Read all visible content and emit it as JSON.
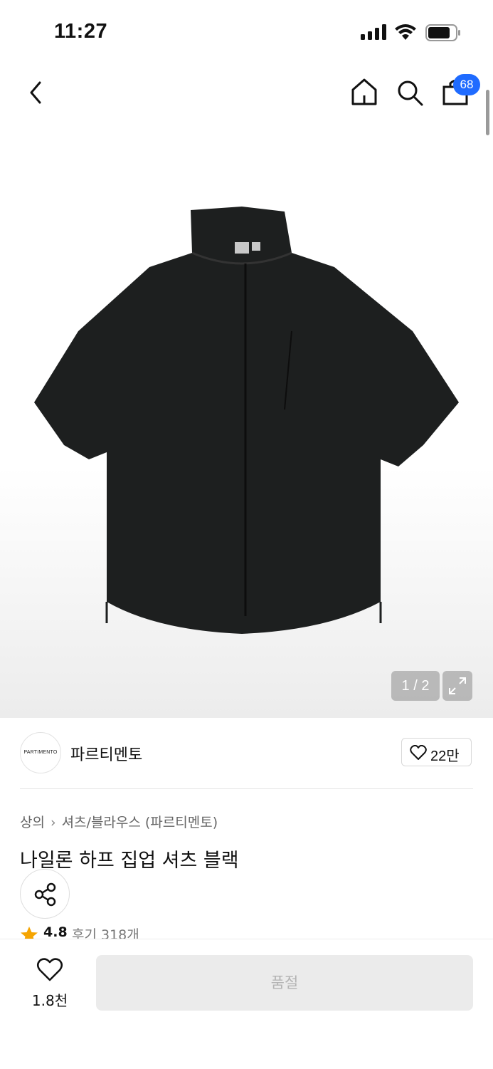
{
  "status": {
    "time": "11:27"
  },
  "header": {
    "cart_count": "68"
  },
  "gallery": {
    "pager": "1 / 2"
  },
  "brand": {
    "logo_text": "PARTIMENTO",
    "name": "파르티멘토",
    "likes": "22만"
  },
  "breadcrumb": {
    "category": "상의",
    "subcategory": "셔츠/블라우스 (파르티멘토)"
  },
  "product": {
    "title": "나일론 하프 집업 셔츠 블랙",
    "rating": "4.8",
    "reviews": "후기 318개"
  },
  "bottom": {
    "likes": "1.8천",
    "buy_label": "품절"
  },
  "colors": {
    "badge": "#1f6bff",
    "star": "#f5a400"
  }
}
